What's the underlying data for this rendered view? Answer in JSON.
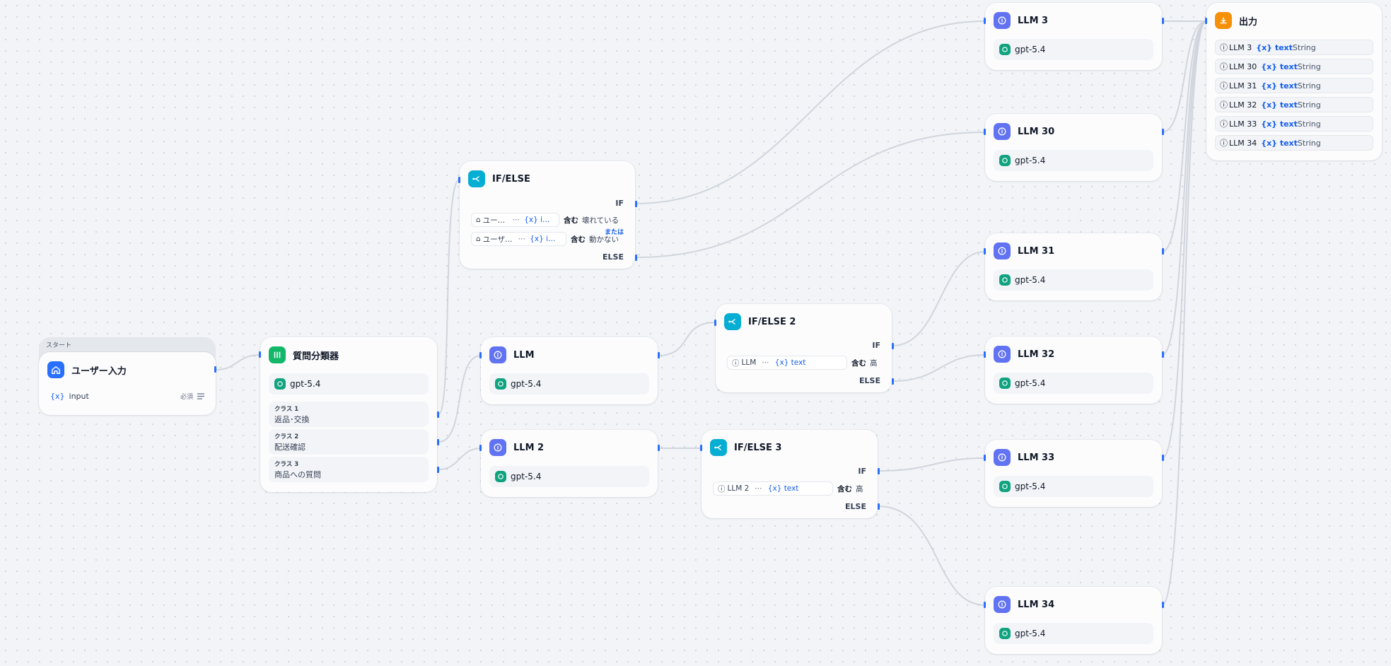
{
  "colors": {
    "llm": "#6172f3",
    "ifelse": "#06aed4",
    "classifier": "#12b76a",
    "start": "#2970ff",
    "output": "#f79009",
    "edge": "#d0d5dd",
    "handle": "#2970ff"
  },
  "start": {
    "group_label": "スタート",
    "title": "ユーザー入力",
    "icon": "home-icon",
    "var_prefix": "{x}",
    "var_name": "input",
    "required": "必須",
    "type_icon": "text-lines-icon"
  },
  "classifier": {
    "title": "質問分類器",
    "icon": "classifier-icon",
    "model": "gpt-5.4",
    "classes": [
      {
        "key": "クラス 1",
        "value": "返品･交換"
      },
      {
        "key": "クラス 2",
        "value": "配送確認"
      },
      {
        "key": "クラス 3",
        "value": "商品への質問"
      }
    ]
  },
  "ifelse1": {
    "title": "IF/ELSE",
    "if_label": "IF",
    "else_label": "ELSE",
    "or_label": "または",
    "conditions": [
      {
        "node": "ユー…",
        "dots": "⋯",
        "var": "{x} i…",
        "op": "含む",
        "value": "壊れている"
      },
      {
        "node": "ユーザ…",
        "dots": "⋯",
        "var": "{x} i…",
        "op": "含む",
        "value": "動かない"
      }
    ]
  },
  "ifelse2": {
    "title": "IF/ELSE 2",
    "if_label": "IF",
    "else_label": "ELSE",
    "condition": {
      "node": "LLM",
      "dots": "⋯",
      "var": "{x} text",
      "op": "含む",
      "value": "高"
    }
  },
  "ifelse3": {
    "title": "IF/ELSE 3",
    "if_label": "IF",
    "else_label": "ELSE",
    "condition": {
      "node": "LLM 2",
      "dots": "⋯",
      "var": "{x} text",
      "op": "含む",
      "value": "高"
    }
  },
  "llm_nodes": [
    {
      "id": "llm",
      "title": "LLM",
      "model": "gpt-5.4"
    },
    {
      "id": "llm2",
      "title": "LLM 2",
      "model": "gpt-5.4"
    },
    {
      "id": "llm3",
      "title": "LLM 3",
      "model": "gpt-5.4"
    },
    {
      "id": "llm30",
      "title": "LLM 30",
      "model": "gpt-5.4"
    },
    {
      "id": "llm31",
      "title": "LLM 31",
      "model": "gpt-5.4"
    },
    {
      "id": "llm32",
      "title": "LLM 32",
      "model": "gpt-5.4"
    },
    {
      "id": "llm33",
      "title": "LLM 33",
      "model": "gpt-5.4"
    },
    {
      "id": "llm34",
      "title": "LLM 34",
      "model": "gpt-5.4"
    }
  ],
  "output": {
    "title": "出力",
    "icon": "output-icon",
    "rows": [
      {
        "node": "LLM 3",
        "var": "{x} text",
        "type": "String"
      },
      {
        "node": "LLM 30",
        "var": "{x} text",
        "type": "String"
      },
      {
        "node": "LLM 31",
        "var": "{x} text",
        "type": "String"
      },
      {
        "node": "LLM 32",
        "var": "{x} text",
        "type": "String"
      },
      {
        "node": "LLM 33",
        "var": "{x} text",
        "type": "String"
      },
      {
        "node": "LLM 34",
        "var": "{x} text",
        "type": "String"
      }
    ]
  }
}
